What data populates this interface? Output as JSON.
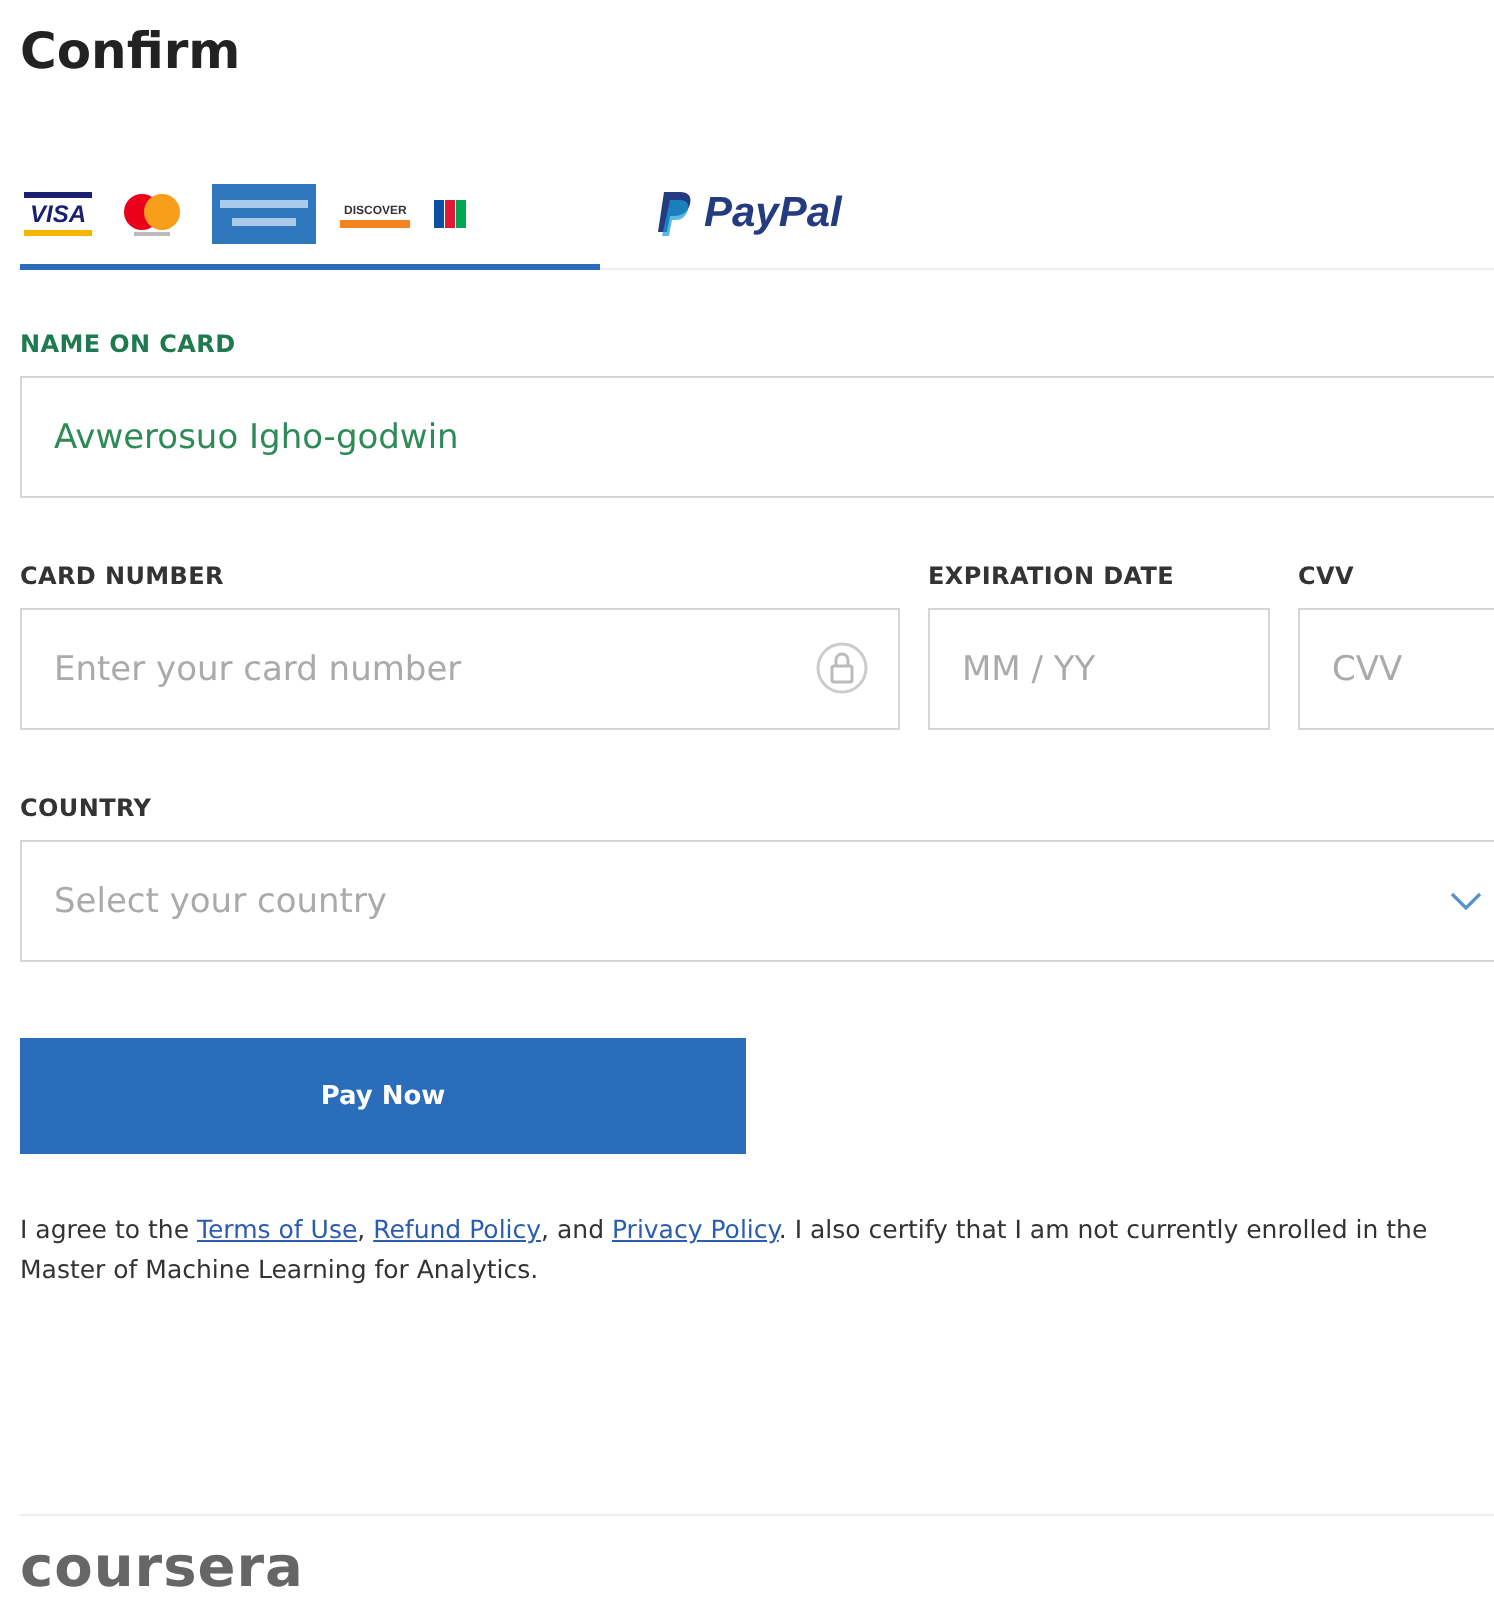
{
  "title": "Confirm",
  "payment_tabs": [
    {
      "kind": "cards",
      "selected": true,
      "visa": "VISA",
      "discover": "DISCOVER"
    },
    {
      "kind": "paypal",
      "selected": false,
      "label": "PayPal"
    }
  ],
  "name_on_card": {
    "label": "NAME ON CARD",
    "value": "Avwerosuo Igho-godwin"
  },
  "card_number": {
    "label": "CARD NUMBER",
    "placeholder": "Enter your card number"
  },
  "expiration_date": {
    "label": "EXPIRATION DATE",
    "placeholder": "MM / YY"
  },
  "cvv": {
    "label": "CVV",
    "placeholder": "CVV"
  },
  "country": {
    "label": "COUNTRY",
    "placeholder": "Select your country"
  },
  "pay_button": "Pay Now",
  "agreement": [
    {
      "kind": "text",
      "text": "I agree to the "
    },
    {
      "kind": "link",
      "text": "Terms of Use"
    },
    {
      "kind": "text",
      "text": ", "
    },
    {
      "kind": "link",
      "text": "Refund Policy"
    },
    {
      "kind": "text",
      "text": ", and "
    },
    {
      "kind": "link",
      "text": "Privacy Policy"
    },
    {
      "kind": "text",
      "text": ". I also certify that I am not currently enrolled in the Master of Machine Learning for Analytics."
    }
  ],
  "footer_logo": "coursera"
}
